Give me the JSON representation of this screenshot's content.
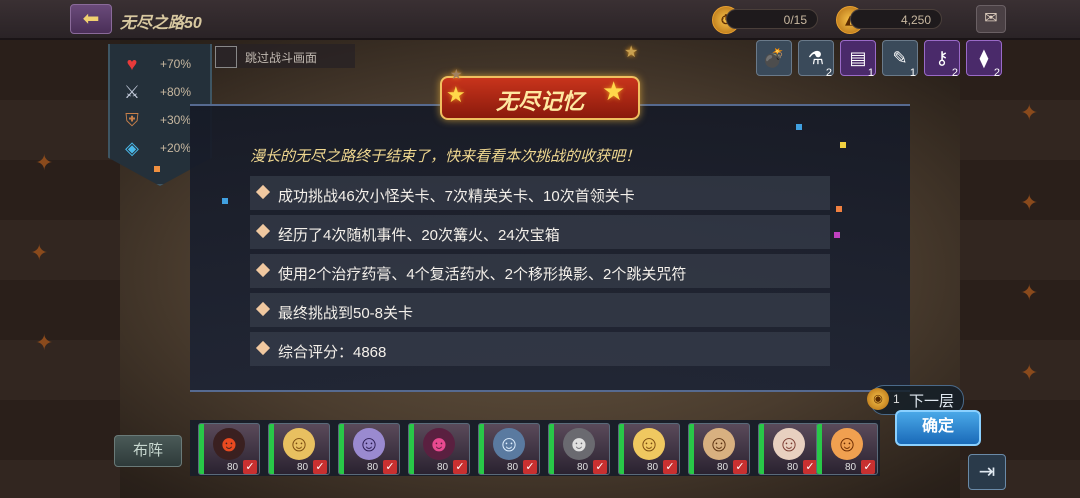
{
  "header": {
    "title": "无尽之路50",
    "stamina": "0/15",
    "currency": "4,250"
  },
  "skip_battle": {
    "label": "跳过战斗画面"
  },
  "buffs": [
    {
      "icon": "heart-icon",
      "value": "+70%"
    },
    {
      "icon": "sword-icon",
      "value": "+80%"
    },
    {
      "icon": "shield-icon",
      "value": "+30%"
    },
    {
      "icon": "crystal-icon",
      "value": "+20%"
    }
  ],
  "items": [
    {
      "icon": "bomb-icon",
      "count": ""
    },
    {
      "icon": "potion-icon",
      "count": "2"
    },
    {
      "icon": "ticket-icon",
      "count": "1"
    },
    {
      "icon": "boot-icon",
      "count": "1"
    },
    {
      "icon": "key-icon",
      "count": "2"
    },
    {
      "icon": "vial-icon",
      "count": "2"
    }
  ],
  "dialog": {
    "title": "无尽记忆",
    "intro": "漫长的无尽之路终于结束了，快来看看本次挑战的收获吧！",
    "rows": [
      "成功挑战46次小怪关卡、7次精英关卡、10次首领关卡",
      "经历了4次随机事件、20次篝火、24次宝箱",
      "使用2个治疗药膏、4个复活药水、2个移形换影、2个跳关咒符",
      "最终挑战到50-8关卡",
      "综合评分：4868"
    ]
  },
  "footer": {
    "formation": "布阵",
    "next_count": "1",
    "next_label": "下一层",
    "confirm": "确定"
  },
  "heroes": [
    {
      "level": "80"
    },
    {
      "level": "80"
    },
    {
      "level": "80"
    },
    {
      "level": "80"
    },
    {
      "level": "80"
    },
    {
      "level": "80"
    },
    {
      "level": "80"
    },
    {
      "level": "80"
    },
    {
      "level": "80"
    },
    {
      "level": "80"
    }
  ]
}
